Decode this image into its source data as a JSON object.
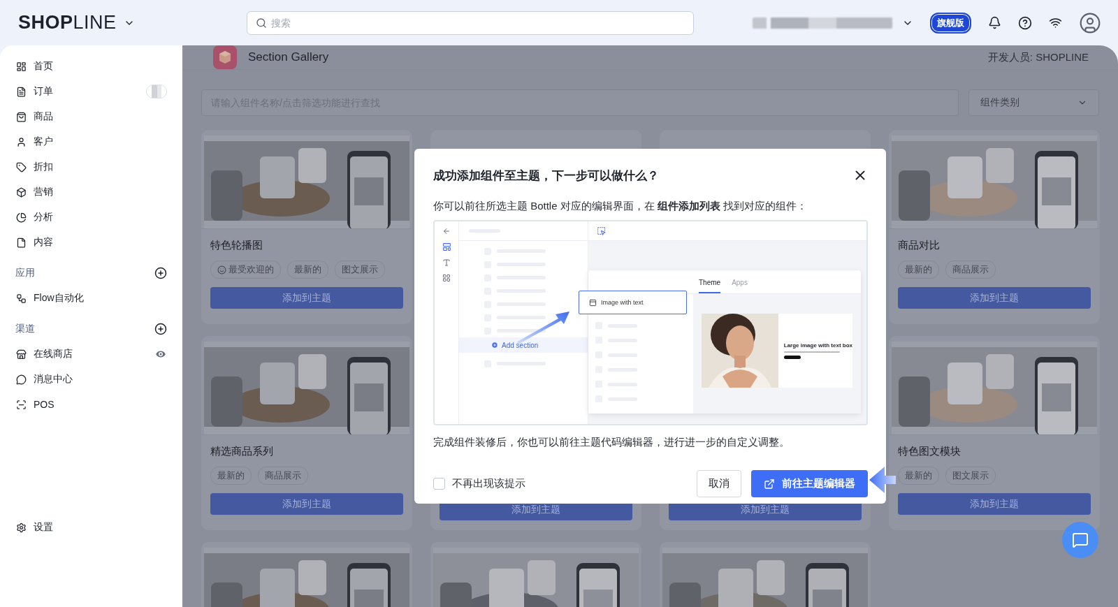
{
  "top_bar": {
    "logo": "**SHOP**LINE",
    "search": {
      "placeholder": "搜索"
    },
    "plan_badge": "旗舰版"
  },
  "sidebar": {
    "sections": [
      {
        "items": [
          {
            "label": "首页",
            "kind": "plain"
          },
          {
            "label": "订单",
            "kind": "with-badge"
          },
          {
            "label": "商品",
            "kind": "plain"
          },
          {
            "label": "客户",
            "kind": "plain"
          },
          {
            "label": "折扣",
            "kind": "plain"
          },
          {
            "label": "营销",
            "kind": "plain"
          },
          {
            "label": "分析",
            "kind": "plain"
          },
          {
            "label": "内容",
            "kind": "plain"
          }
        ]
      },
      {
        "title": "应用",
        "items": [
          {
            "label": "Flow自动化",
            "kind": "plain"
          }
        ]
      },
      {
        "title": "渠道",
        "items": [
          {
            "label": "在线商店",
            "kind": "with-eye"
          },
          {
            "label": "消息中心",
            "kind": "plain"
          },
          {
            "label": "POS",
            "kind": "plain"
          }
        ]
      }
    ],
    "footer_item": {
      "label": "设置"
    }
  },
  "gallery": {
    "title": "Section Gallery",
    "developer": "开发人员: SHOPLINE",
    "search": {
      "placeholder": "请输入组件名称/点击筛选功能进行查找"
    },
    "category_select": "组件类别",
    "cards": [
      {
        "kind": "full",
        "title": "特色轮播图",
        "tags": [
          {
            "label": "最受欢迎的",
            "kind": "popular"
          },
          {
            "label": "最新的",
            "kind": "plain"
          },
          {
            "label": "图文展示",
            "kind": "plain"
          }
        ],
        "button": "添加到主题"
      },
      {
        "kind": "covered"
      },
      {
        "kind": "covered"
      },
      {
        "kind": "full",
        "title": "商品对比",
        "tags": [
          {
            "label": "最新的",
            "kind": "plain"
          },
          {
            "label": "商品展示",
            "kind": "plain"
          }
        ],
        "button": "添加到主题"
      },
      {
        "kind": "full",
        "title": "精选商品系列",
        "tags": [
          {
            "label": "最新的",
            "kind": "plain"
          },
          {
            "label": "商品展示",
            "kind": "plain"
          }
        ],
        "button": "添加到主题"
      },
      {
        "kind": "partial",
        "button": "添加到主题"
      },
      {
        "kind": "partial",
        "button": "添加到主题"
      },
      {
        "kind": "full",
        "title": "特色图文模块",
        "tags": [
          {
            "label": "最新的",
            "kind": "plain"
          },
          {
            "label": "图文展示",
            "kind": "plain"
          }
        ],
        "button": "添加到主题"
      },
      {
        "kind": "preview"
      },
      {
        "kind": "preview"
      },
      {
        "kind": "preview"
      }
    ]
  },
  "modal": {
    "title": "成功添加组件至主题，下一步可以做什么？",
    "intro": "你可以前往所选主题 Bottle 对应的编辑界面，在 **组件添加列表** 找到对应的组件：",
    "illustration": {
      "tabs": [
        {
          "label": "Theme",
          "selected": true
        },
        {
          "label": "Apps",
          "selected": false
        }
      ],
      "section_item": "Image with text",
      "add_button": "Add section",
      "preview_heading": "Large image with text box"
    },
    "note": "完成组件装修后，你也可以前往主题代码编辑器，进行进一步的自定义调整。",
    "dont_show": {
      "label": "不再出现该提示",
      "checked": false
    },
    "cancel": "取消",
    "confirm": "前往主题编辑器"
  }
}
